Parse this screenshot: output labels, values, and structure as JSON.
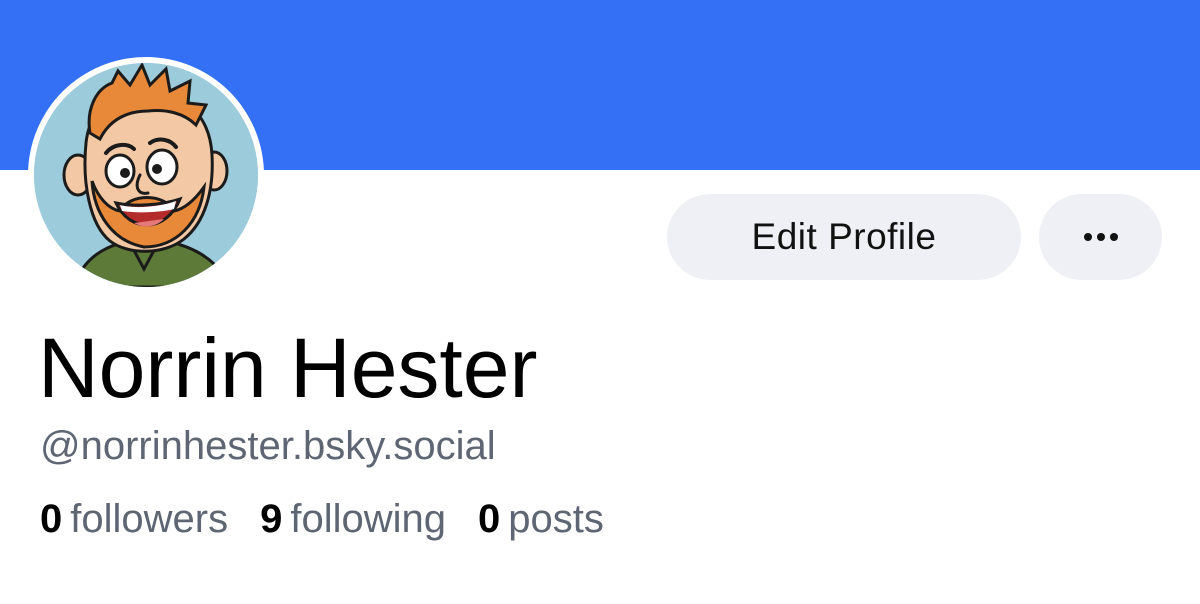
{
  "profile": {
    "display_name": "Norrin Hester",
    "handle": "@norrinhester.bsky.social",
    "avatar_icon": "cartoon-avatar"
  },
  "actions": {
    "edit_label": "Edit Profile",
    "more_icon": "ellipsis-icon"
  },
  "stats": [
    {
      "value": "0",
      "label": "followers"
    },
    {
      "value": "9",
      "label": "following"
    },
    {
      "value": "0",
      "label": "posts"
    }
  ],
  "colors": {
    "banner": "#3370f6",
    "button_bg": "#eff0f5",
    "secondary_text": "#5f6673"
  }
}
